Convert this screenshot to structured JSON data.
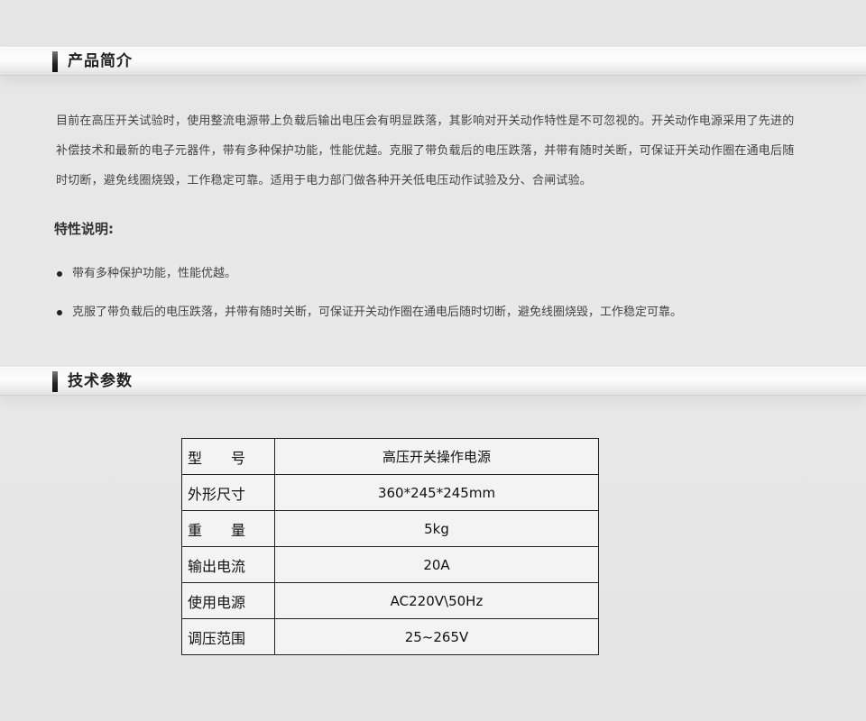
{
  "sections": {
    "intro": {
      "title": "产品简介"
    },
    "params": {
      "title": "技术参数"
    }
  },
  "intro": {
    "paragraph": "目前在高压开关试验时，使用整流电源带上负载后输出电压会有明显跌落，其影响对开关动作特性是不可忽视的。开关动作电源采用了先进的补偿技术和最新的电子元器件，带有多种保护功能，性能优越。克服了带负载后的电压跌落，并带有随时关断，可保证开关动作圈在通电后随时切断，避免线圈烧毁，工作稳定可靠。适用于电力部门做各种开关低电压动作试验及分、合闸试验。"
  },
  "features": {
    "title": "特性说明:",
    "items": [
      "带有多种保护功能，性能优越。",
      "克服了带负载后的电压跌落，并带有随时关断，可保证开关动作圈在通电后随时切断，避免线圈烧毁，工作稳定可靠。"
    ]
  },
  "specs": {
    "rows": [
      {
        "label": "型　　号",
        "value": "高压开关操作电源"
      },
      {
        "label": "外形尺寸",
        "value": "360*245*245mm"
      },
      {
        "label": "重　　量",
        "value": "5kg"
      },
      {
        "label": "输出电流",
        "value": "20A"
      },
      {
        "label": "使用电源",
        "value": "AC220V\\50Hz"
      },
      {
        "label": "调压范围",
        "value": "25~265V"
      }
    ]
  }
}
